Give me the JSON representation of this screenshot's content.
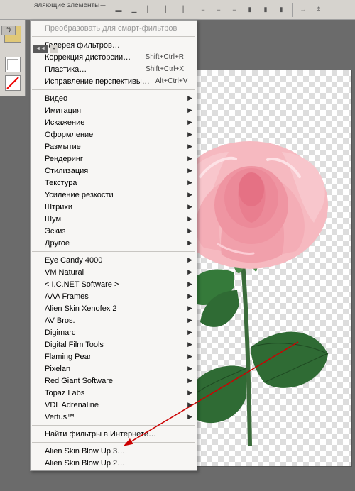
{
  "toolbar": {
    "panel_title": "яляющие элементы",
    "close_tab": "*)",
    "close_btn": "×",
    "grip": "◄◄"
  },
  "menu": {
    "groups": [
      {
        "items": [
          {
            "label": "Преобразовать для смарт-фильтров",
            "submenu": false,
            "disabled": true
          }
        ]
      },
      {
        "items": [
          {
            "label": "Галерея фильтров…",
            "submenu": false
          },
          {
            "label": "Коррекция дисторсии…",
            "shortcut": "Shift+Ctrl+R",
            "submenu": false
          },
          {
            "label": "Пластика…",
            "shortcut": "Shift+Ctrl+X",
            "submenu": false
          },
          {
            "label": "Исправление перспективы…",
            "shortcut": "Alt+Ctrl+V",
            "submenu": false
          }
        ]
      },
      {
        "items": [
          {
            "label": "Видео",
            "submenu": true
          },
          {
            "label": "Имитация",
            "submenu": true
          },
          {
            "label": "Искажение",
            "submenu": true
          },
          {
            "label": "Оформление",
            "submenu": true
          },
          {
            "label": "Размытие",
            "submenu": true
          },
          {
            "label": "Рендеринг",
            "submenu": true
          },
          {
            "label": "Стилизация",
            "submenu": true
          },
          {
            "label": "Текстура",
            "submenu": true
          },
          {
            "label": "Усиление резкости",
            "submenu": true
          },
          {
            "label": "Штрихи",
            "submenu": true
          },
          {
            "label": "Шум",
            "submenu": true
          },
          {
            "label": "Эскиз",
            "submenu": true
          },
          {
            "label": "Другое",
            "submenu": true
          }
        ]
      },
      {
        "items": [
          {
            "label": " Eye Candy 4000",
            "submenu": true
          },
          {
            "label": " VM Natural",
            "submenu": true
          },
          {
            "label": "< I.C.NET Software >",
            "submenu": true
          },
          {
            "label": "AAA Frames",
            "submenu": true
          },
          {
            "label": "Alien Skin Xenofex 2",
            "submenu": true
          },
          {
            "label": "AV Bros.",
            "submenu": true
          },
          {
            "label": "Digimarc",
            "submenu": true
          },
          {
            "label": "Digital Film Tools",
            "submenu": true
          },
          {
            "label": "Flaming Pear",
            "submenu": true
          },
          {
            "label": "Pixelan",
            "submenu": true
          },
          {
            "label": "Red Giant Software",
            "submenu": true
          },
          {
            "label": "Topaz Labs",
            "submenu": true
          },
          {
            "label": "VDL Adrenaline",
            "submenu": true
          },
          {
            "label": "Vertus™",
            "submenu": true
          }
        ]
      },
      {
        "items": [
          {
            "label": "Найти фильтры в Интернете…",
            "submenu": false
          }
        ]
      },
      {
        "items": [
          {
            "label": "Alien Skin Blow Up 3…",
            "submenu": false
          },
          {
            "label": "Alien Skin Blow Up 2…",
            "submenu": false
          }
        ]
      }
    ]
  }
}
